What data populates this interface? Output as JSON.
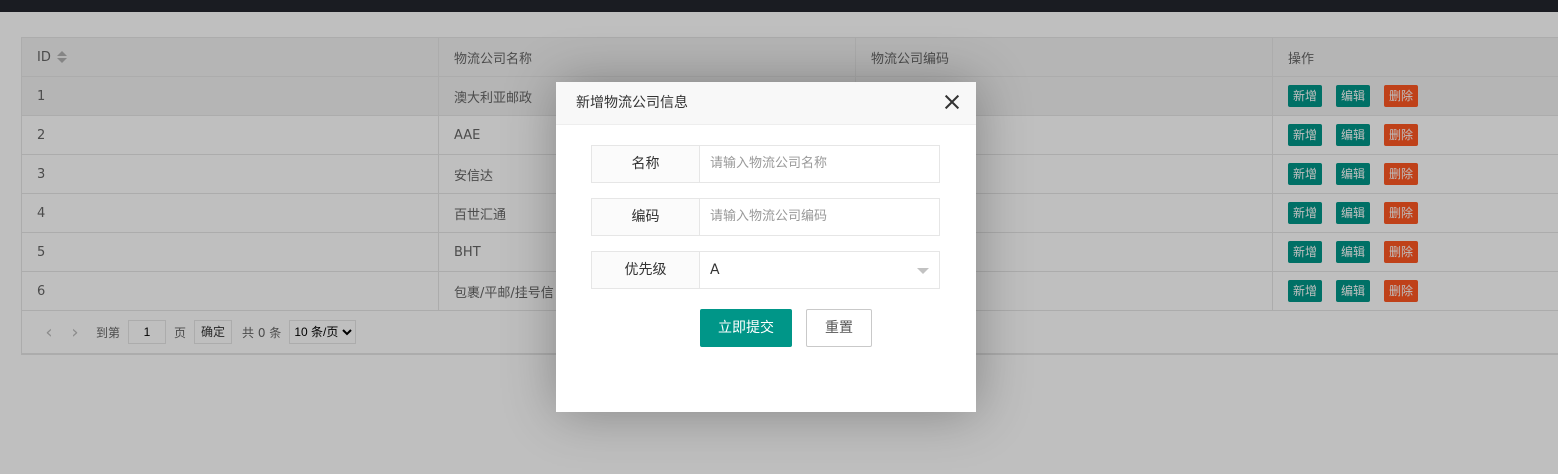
{
  "table": {
    "headers": {
      "id": "ID",
      "name": "物流公司名称",
      "code": "物流公司编码",
      "ops": "操作"
    },
    "rows": [
      {
        "id": "1",
        "name": "澳大利亚邮政"
      },
      {
        "id": "2",
        "name": "AAE"
      },
      {
        "id": "3",
        "name": "安信达"
      },
      {
        "id": "4",
        "name": "百世汇通"
      },
      {
        "id": "5",
        "name": "BHT"
      },
      {
        "id": "6",
        "name": "包裹/平邮/挂号信"
      }
    ],
    "actions": {
      "add": "新增",
      "edit": "编辑",
      "delete": "删除"
    }
  },
  "pagination": {
    "goto_label": "到第",
    "page_value": "1",
    "page_label": "页",
    "confirm": "确定",
    "total": "共 0 条",
    "page_size": "10 条/页"
  },
  "modal": {
    "title": "新增物流公司信息",
    "name_label": "名称",
    "name_placeholder": "请输入物流公司名称",
    "code_label": "编码",
    "code_placeholder": "请输入物流公司编码",
    "priority_label": "优先级",
    "priority_value": "A",
    "submit": "立即提交",
    "reset": "重置"
  },
  "colors": {
    "green": "#009688",
    "red": "#ff5722"
  }
}
